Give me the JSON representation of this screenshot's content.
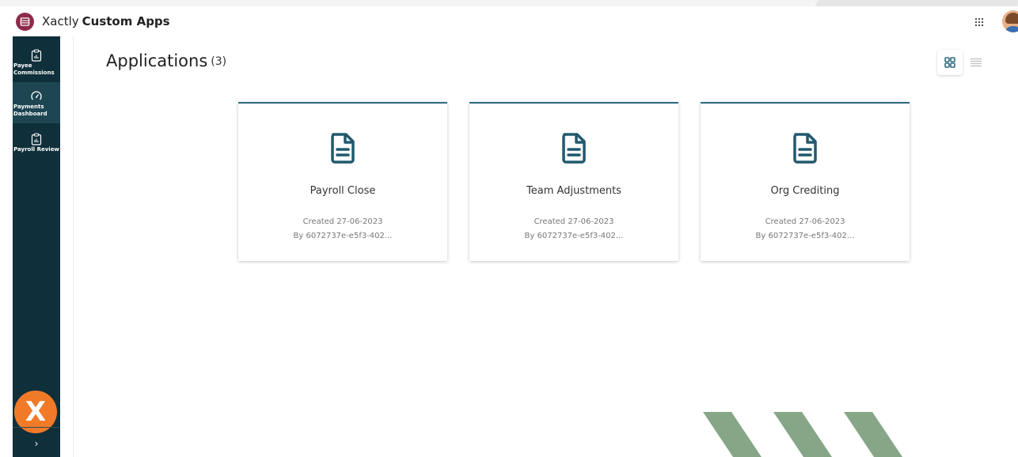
{
  "app": {
    "brand": "Xactly",
    "product": "Custom Apps"
  },
  "sidebar": {
    "items": [
      {
        "label_line1": "Payee",
        "label_line2": "Commissions",
        "icon": "clipboard-chart-icon"
      },
      {
        "label_line1": "Payments",
        "label_line2": "Dashboard",
        "icon": "gauge-icon"
      },
      {
        "label_line1": "Payroll Review",
        "label_line2": "",
        "icon": "clipboard-chart-icon"
      }
    ],
    "logo_letter": "X",
    "expand_glyph": "›"
  },
  "page": {
    "title": "Applications",
    "count": "(3)"
  },
  "cards": [
    {
      "title": "Payroll Close",
      "created": "Created 27-06-2023",
      "author": "By 6072737e-e5f3-402..."
    },
    {
      "title": "Team Adjustments",
      "created": "Created 27-06-2023",
      "author": "By 6072737e-e5f3-402..."
    },
    {
      "title": "Org Crediting",
      "created": "Created 27-06-2023",
      "author": "By 6072737e-e5f3-402..."
    }
  ],
  "colors": {
    "sidebar_bg": "#0f2f3a",
    "accent": "#2f6b82",
    "logo_orange": "#f07a28",
    "app_logo": "#8e2b4a",
    "chevron_green": "#86a687"
  }
}
